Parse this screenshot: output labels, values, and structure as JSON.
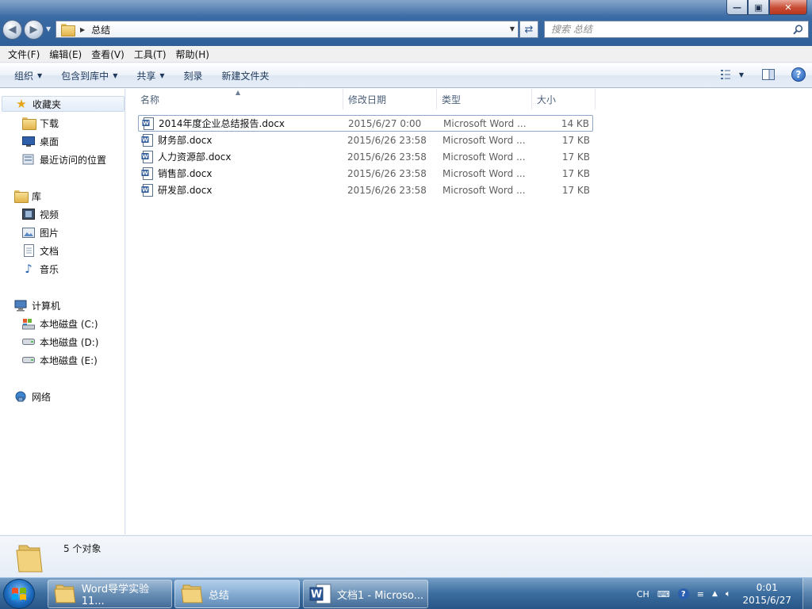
{
  "window": {
    "address": {
      "path_segment": "总结"
    },
    "search": {
      "placeholder": "搜索 总结"
    },
    "menubar": [
      "文件(F)",
      "编辑(E)",
      "查看(V)",
      "工具(T)",
      "帮助(H)"
    ],
    "commands": {
      "organize": "组织",
      "include_in_library": "包含到库中",
      "share": "共享",
      "burn": "刻录",
      "new_folder": "新建文件夹"
    },
    "navpane": {
      "favorites": {
        "label": "收藏夹",
        "items": [
          "下载",
          "桌面",
          "最近访问的位置"
        ]
      },
      "libraries": {
        "label": "库",
        "items": [
          "视频",
          "图片",
          "文档",
          "音乐"
        ]
      },
      "computer": {
        "label": "计算机",
        "items": [
          "本地磁盘 (C:)",
          "本地磁盘 (D:)",
          "本地磁盘 (E:)"
        ]
      },
      "network": {
        "label": "网络"
      }
    },
    "columns": {
      "name": "名称",
      "date": "修改日期",
      "type": "类型",
      "size": "大小"
    },
    "files": [
      {
        "name": "2014年度企业总结报告.docx",
        "date": "2015/6/27 0:00",
        "type": "Microsoft Word ...",
        "size": "14 KB",
        "selected": true
      },
      {
        "name": "财务部.docx",
        "date": "2015/6/26 23:58",
        "type": "Microsoft Word ...",
        "size": "17 KB"
      },
      {
        "name": "人力资源部.docx",
        "date": "2015/6/26 23:58",
        "type": "Microsoft Word ...",
        "size": "17 KB"
      },
      {
        "name": "销售部.docx",
        "date": "2015/6/26 23:58",
        "type": "Microsoft Word ...",
        "size": "17 KB"
      },
      {
        "name": "研发部.docx",
        "date": "2015/6/26 23:58",
        "type": "Microsoft Word ...",
        "size": "17 KB"
      }
    ],
    "details": {
      "count_text": "5 个对象"
    }
  },
  "taskbar": {
    "buttons": [
      {
        "label": "Word导学实验11...",
        "icon": "folder-icon"
      },
      {
        "label": "总结",
        "icon": "folder-icon",
        "active": true
      },
      {
        "label": "文档1 - Microso...",
        "icon": "word-icon"
      }
    ],
    "tray": {
      "lang": "CH",
      "time": "0:01",
      "date": "2015/6/27"
    }
  },
  "colors": {
    "titlebar": "#3a6aa3",
    "command_text": "#1e395b",
    "selection_border": "#8fa8c8",
    "taskbar": "#3c6ea0"
  }
}
